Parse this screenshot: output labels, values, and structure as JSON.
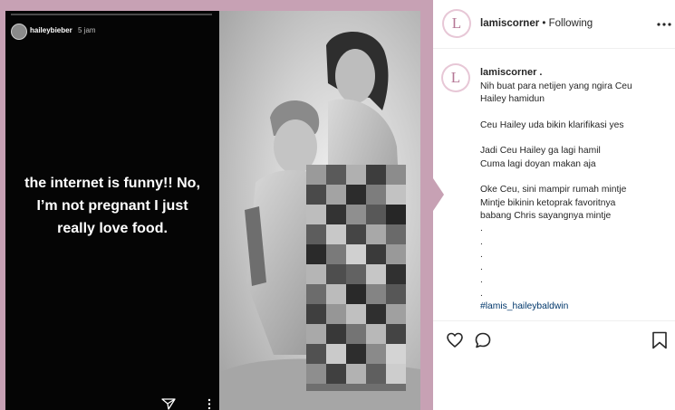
{
  "post": {
    "story": {
      "username": "haileybieber",
      "time": "5 jam",
      "text_lines": [
        "the internet is funny!! No,",
        "I’m not pregnant I just",
        "really love food."
      ]
    },
    "icons": [
      "send-icon",
      "more-icon",
      "pixelation-censor"
    ]
  },
  "header": {
    "avatar_letter": "L",
    "username": "lamiscorner",
    "separator": " • ",
    "follow_status": "Following",
    "more_icon": "ellipsis-icon"
  },
  "caption": {
    "avatar_letter": "L",
    "username": "lamiscorner .",
    "lines": [
      "Nih buat para netijen yang ngira Ceu",
      "Hailey hamidun",
      "",
      "Ceu Hailey uda bikin klarifikasi yes",
      "",
      "Jadi Ceu Hailey ga lagi hamil",
      "Cuma lagi doyan makan aja",
      "",
      "Oke Ceu, sini mampir rumah mintje",
      "Mintje bikinin ketoprak favoritnya",
      "babang Chris sayangnya mintje",
      ".",
      ".",
      ".",
      ".",
      ".",
      "."
    ],
    "hashtag": "#lamis_haileybaldwin"
  },
  "actions": {
    "icons": [
      "heart-icon",
      "comment-icon",
      "bookmark-icon"
    ]
  },
  "colors": {
    "frame": "#c7a1b4",
    "hashtag": "#00376b",
    "text": "#262626"
  }
}
